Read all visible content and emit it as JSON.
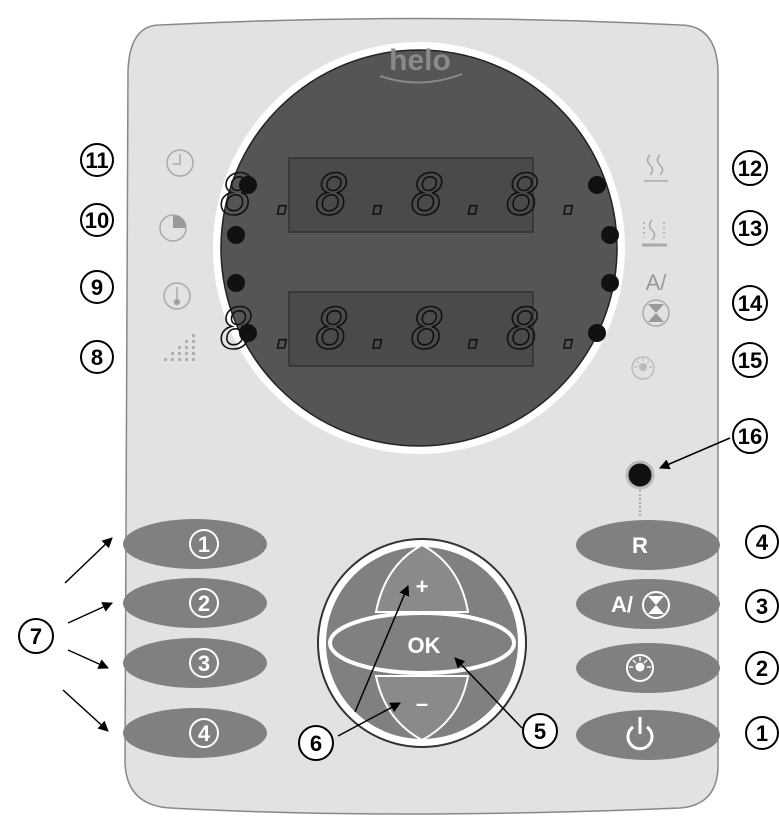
{
  "brand": "helo",
  "display": {
    "top_readout": "8.8.8.8.",
    "bottom_readout": "8.8.8.8."
  },
  "left_icons": [
    {
      "icon": "clock-icon"
    },
    {
      "icon": "pie-timer-icon"
    },
    {
      "icon": "thermometer-icon"
    },
    {
      "icon": "signal-bars-icon"
    }
  ],
  "right_icons": [
    {
      "icon": "steam-low-icon"
    },
    {
      "icon": "steam-high-icon"
    },
    {
      "icon": "auto-fan-icon",
      "text": "A/"
    },
    {
      "icon": "light-icon"
    }
  ],
  "callouts": {
    "c11": "11",
    "c10": "10",
    "c9": "9",
    "c8": "8",
    "c12": "12",
    "c13": "13",
    "c14": "14",
    "c15": "15",
    "c16": "16",
    "c7": "7",
    "c6": "6",
    "c5": "5",
    "r4": "4",
    "r3": "3",
    "r2": "2",
    "r1": "1"
  },
  "left_buttons": [
    "1",
    "2",
    "3",
    "4"
  ],
  "right_buttons": {
    "reset": "R",
    "auto_fan": "A/",
    "light": "",
    "power": ""
  },
  "joystick": {
    "ok": "OK",
    "plus": "+",
    "minus": "–"
  },
  "colors": {
    "panel": "#e2e2e2",
    "display_ring": "#ffffff",
    "display_face": "#555555",
    "button": "#808080",
    "led": "#111111"
  }
}
